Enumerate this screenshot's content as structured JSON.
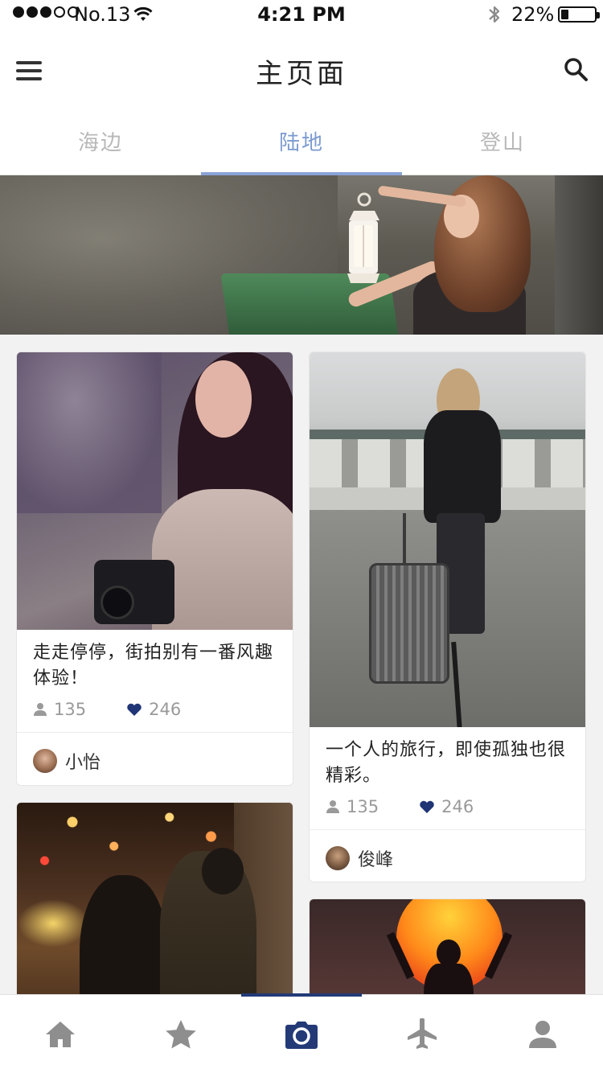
{
  "status_bar": {
    "signal_dots_filled": 3,
    "signal_dots_total": 5,
    "carrier": "No.13",
    "time": "4:21 PM",
    "battery_percent": "22%",
    "battery_level": 0.22
  },
  "header": {
    "title": "主页面"
  },
  "tabs": [
    {
      "label": "海边",
      "active": false
    },
    {
      "label": "陆地",
      "active": true
    },
    {
      "label": "登山",
      "active": false
    }
  ],
  "cards": [
    {
      "caption": "走走停停，街拍别有一番风趣体验！",
      "views": "135",
      "likes": "246",
      "author": "小怡"
    },
    {
      "caption": "一个人的旅行，即使孤独也很精彩。",
      "views": "135",
      "likes": "246",
      "author": "俊峰"
    }
  ],
  "bottom_nav": [
    {
      "icon": "home-icon",
      "active": false
    },
    {
      "icon": "star-icon",
      "active": false
    },
    {
      "icon": "camera-icon",
      "active": true
    },
    {
      "icon": "plane-icon",
      "active": false
    },
    {
      "icon": "user-icon",
      "active": false
    }
  ],
  "colors": {
    "accent": "#7c9bd0",
    "tab_indicator": "#8aa3d6",
    "nav_active": "#233a77",
    "nav_inactive": "#8e8e8e",
    "like_heart": "#1f3575",
    "muted_text": "#9a9a9a"
  }
}
